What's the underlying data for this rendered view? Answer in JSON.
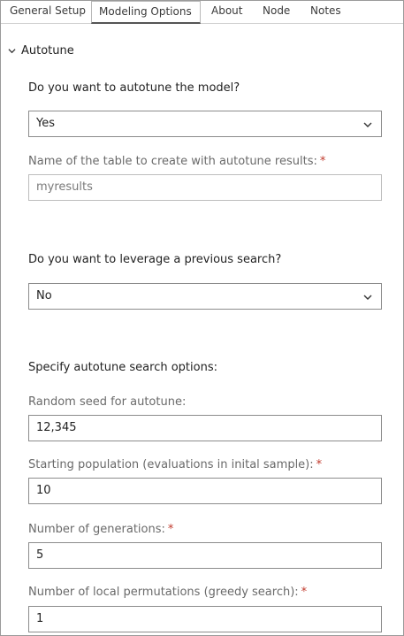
{
  "tabs": [
    {
      "label": "General Setup"
    },
    {
      "label": "Modeling Options"
    },
    {
      "label": "About"
    },
    {
      "label": "Node"
    },
    {
      "label": "Notes"
    }
  ],
  "section": {
    "title": "Autotune"
  },
  "autotune_question": "Do you want to autotune the model?",
  "autotune_select": {
    "value": "Yes"
  },
  "results_table": {
    "label": "Name of the table to create with autotune results:",
    "value": "myresults"
  },
  "previous_question": "Do you want to leverage a previous search?",
  "previous_select": {
    "value": "No"
  },
  "search_options_heading": "Specify autotune search options:",
  "random_seed": {
    "label": "Random seed for autotune:",
    "value": "12,345"
  },
  "starting_population": {
    "label": "Starting population (evaluations in inital sample):",
    "value": "10"
  },
  "generations": {
    "label": "Number of generations:",
    "value": "5"
  },
  "local_permutations": {
    "label": "Number of local permutations (greedy search):",
    "value": "1"
  },
  "required_marker": "*",
  "colors": {
    "required": "#c0392b",
    "label_muted": "#6a6a6a",
    "border": "#8c8c8c"
  }
}
